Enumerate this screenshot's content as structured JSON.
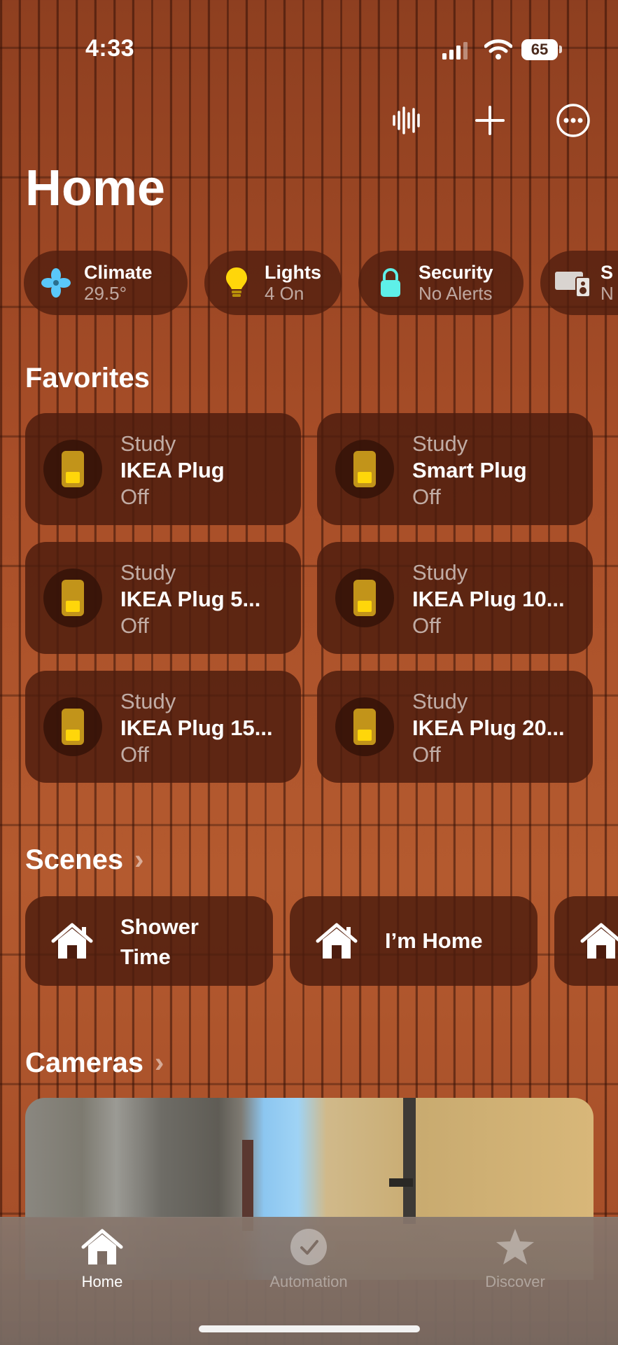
{
  "status_bar": {
    "time": "4:33",
    "battery": "65"
  },
  "page": {
    "title": "Home"
  },
  "categories": [
    {
      "label": "Climate",
      "value": "29.5°",
      "icon": "fan-icon"
    },
    {
      "label": "Lights",
      "value": "4 On",
      "icon": "lightbulb-icon"
    },
    {
      "label": "Security",
      "value": "No Alerts",
      "icon": "lock-icon"
    },
    {
      "label": "S",
      "value": "N",
      "icon": "speaker-tv-icon"
    }
  ],
  "favorites": {
    "title": "Favorites",
    "items": [
      {
        "room": "Study",
        "name": "IKEA Plug",
        "state": "Off"
      },
      {
        "room": "Study",
        "name": "Smart Plug",
        "state": "Off"
      },
      {
        "room": "Study",
        "name": "IKEA Plug 5...",
        "state": "Off"
      },
      {
        "room": "Study",
        "name": "IKEA Plug 10...",
        "state": "Off"
      },
      {
        "room": "Study",
        "name": "IKEA Plug 15...",
        "state": "Off"
      },
      {
        "room": "Study",
        "name": "IKEA Plug 20...",
        "state": "Off"
      }
    ]
  },
  "scenes": {
    "title": "Scenes",
    "items": [
      {
        "line1": "Shower",
        "line2": "Time"
      },
      {
        "line1": "I’m Home"
      }
    ]
  },
  "cameras": {
    "title": "Cameras"
  },
  "tabs": [
    {
      "label": "Home",
      "icon": "house-icon",
      "active": true
    },
    {
      "label": "Automation",
      "icon": "clock-icon",
      "active": false
    },
    {
      "label": "Discover",
      "icon": "star-icon",
      "active": false
    }
  ],
  "colors": {
    "accent_plug": "#ffd60a",
    "tile_bg": "#4c1c0e",
    "background": "#a04a26"
  }
}
